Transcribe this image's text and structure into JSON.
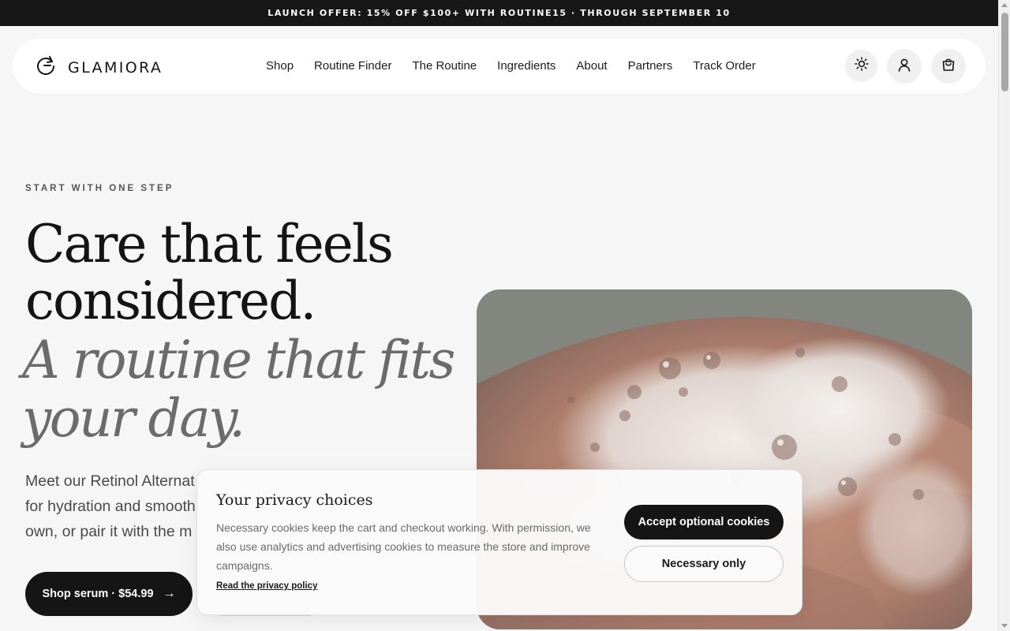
{
  "announcement": "LAUNCH OFFER: 15% OFF $100+ WITH ROUTINE15 · THROUGH SEPTEMBER 10",
  "brand": {
    "name": "GLAMIORA",
    "logo_icon": "refresh-circle-icon"
  },
  "nav": {
    "items": [
      "Shop",
      "Routine Finder",
      "The Routine",
      "Ingredients",
      "About",
      "Partners",
      "Track Order"
    ]
  },
  "header_icons": {
    "theme": "sun-icon",
    "account": "user-icon",
    "cart": "shopping-bag-icon"
  },
  "hero": {
    "eyebrow": "START WITH ONE STEP",
    "headline_line1": "Care that feels",
    "headline_line2": "considered.",
    "italic_line1": "A routine that fits",
    "italic_line2": "your day.",
    "lead_line1": "Meet our Retinol Alternat",
    "lead_line2": "for hydration and smooth",
    "lead_line3": "own, or pair it with the m",
    "shop_button": "Shop serum · $54.99",
    "shop_button_icon": "arrow-right-icon"
  },
  "cookie_banner": {
    "title": "Your privacy choices",
    "body": "Necessary cookies keep the cart and checkout working. With permission, we also use analytics and advertising cookies to measure the store and improve campaigns.",
    "link": "Read the privacy policy",
    "accept_label": "Accept optional cookies",
    "necessary_label": "Necessary only"
  },
  "colors": {
    "dark": "#151515",
    "muted": "#6b6b6b",
    "background": "#f6f6f7"
  }
}
